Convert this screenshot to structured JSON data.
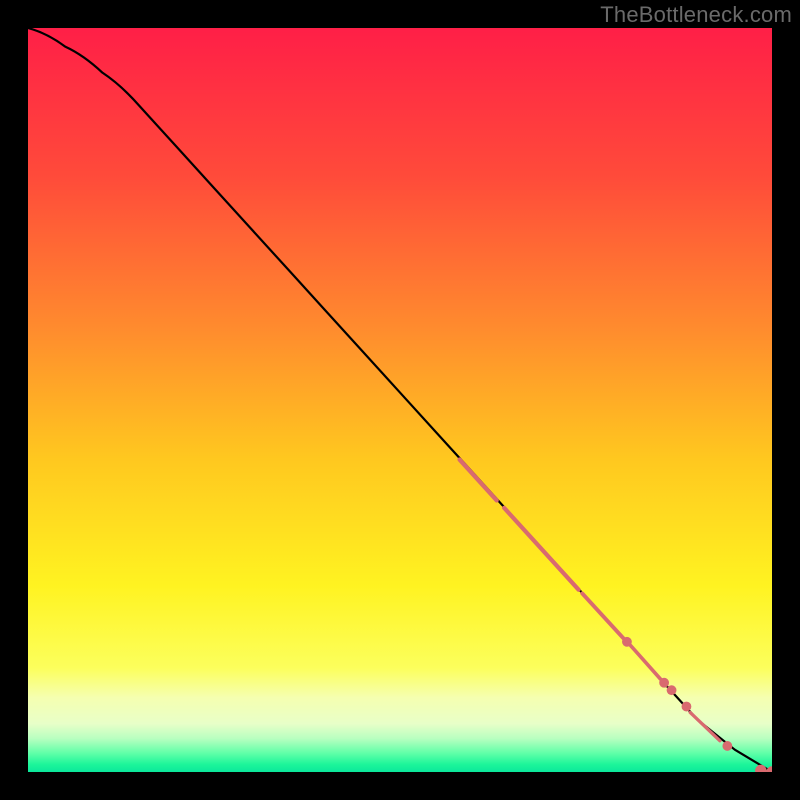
{
  "watermark": "TheBottleneck.com",
  "chart_data": {
    "type": "line",
    "title": "",
    "xlabel": "",
    "ylabel": "",
    "xlim": [
      0,
      100
    ],
    "ylim": [
      0,
      100
    ],
    "grid": false,
    "legend": false,
    "gradient_stops": [
      {
        "offset": 0.0,
        "color": "#ff1f47"
      },
      {
        "offset": 0.2,
        "color": "#ff4b3a"
      },
      {
        "offset": 0.4,
        "color": "#ff8a2e"
      },
      {
        "offset": 0.58,
        "color": "#ffc81f"
      },
      {
        "offset": 0.75,
        "color": "#fff321"
      },
      {
        "offset": 0.86,
        "color": "#fcff5c"
      },
      {
        "offset": 0.9,
        "color": "#f5ffb0"
      },
      {
        "offset": 0.935,
        "color": "#e8ffc8"
      },
      {
        "offset": 0.955,
        "color": "#b8ffc0"
      },
      {
        "offset": 0.975,
        "color": "#5effa8"
      },
      {
        "offset": 0.99,
        "color": "#1cf59a"
      },
      {
        "offset": 1.0,
        "color": "#0be79b"
      }
    ],
    "curve": [
      {
        "x": 0,
        "y": 100
      },
      {
        "x": 5,
        "y": 97.5
      },
      {
        "x": 10,
        "y": 94
      },
      {
        "x": 15,
        "y": 89.5
      },
      {
        "x": 20,
        "y": 84
      },
      {
        "x": 25,
        "y": 78.5
      },
      {
        "x": 30,
        "y": 73
      },
      {
        "x": 35,
        "y": 67.5
      },
      {
        "x": 40,
        "y": 62
      },
      {
        "x": 45,
        "y": 56.5
      },
      {
        "x": 50,
        "y": 51
      },
      {
        "x": 55,
        "y": 45.5
      },
      {
        "x": 60,
        "y": 40
      },
      {
        "x": 65,
        "y": 34.5
      },
      {
        "x": 70,
        "y": 29
      },
      {
        "x": 75,
        "y": 23.5
      },
      {
        "x": 80,
        "y": 18
      },
      {
        "x": 85,
        "y": 12.5
      },
      {
        "x": 90,
        "y": 7
      },
      {
        "x": 95,
        "y": 3
      },
      {
        "x": 100,
        "y": 0
      }
    ],
    "segments": [
      {
        "x0": 58,
        "y0": 42.0,
        "x1": 63,
        "y1": 36.5,
        "w": 2.6
      },
      {
        "x0": 64,
        "y0": 35.5,
        "x1": 74,
        "y1": 24.5,
        "w": 2.6
      },
      {
        "x0": 74.5,
        "y0": 24.0,
        "x1": 80,
        "y1": 18.0,
        "w": 2.4
      },
      {
        "x0": 81,
        "y0": 17.0,
        "x1": 85,
        "y1": 12.5,
        "w": 2.2
      },
      {
        "x0": 89,
        "y0": 8.0,
        "x1": 93,
        "y1": 4.2,
        "w": 2.0
      }
    ],
    "dots": [
      {
        "x": 80.5,
        "y": 17.5,
        "r": 1.2
      },
      {
        "x": 85.5,
        "y": 12.0,
        "r": 1.2
      },
      {
        "x": 86.5,
        "y": 11.0,
        "r": 1.2
      },
      {
        "x": 88.5,
        "y": 8.8,
        "r": 1.2
      },
      {
        "x": 94.0,
        "y": 3.5,
        "r": 1.2
      },
      {
        "x": 98.5,
        "y": 0.2,
        "r": 1.4
      },
      {
        "x": 100.0,
        "y": 0.0,
        "r": 1.4
      }
    ],
    "marker_color": "#d96a6f",
    "curve_color": "#000000"
  }
}
